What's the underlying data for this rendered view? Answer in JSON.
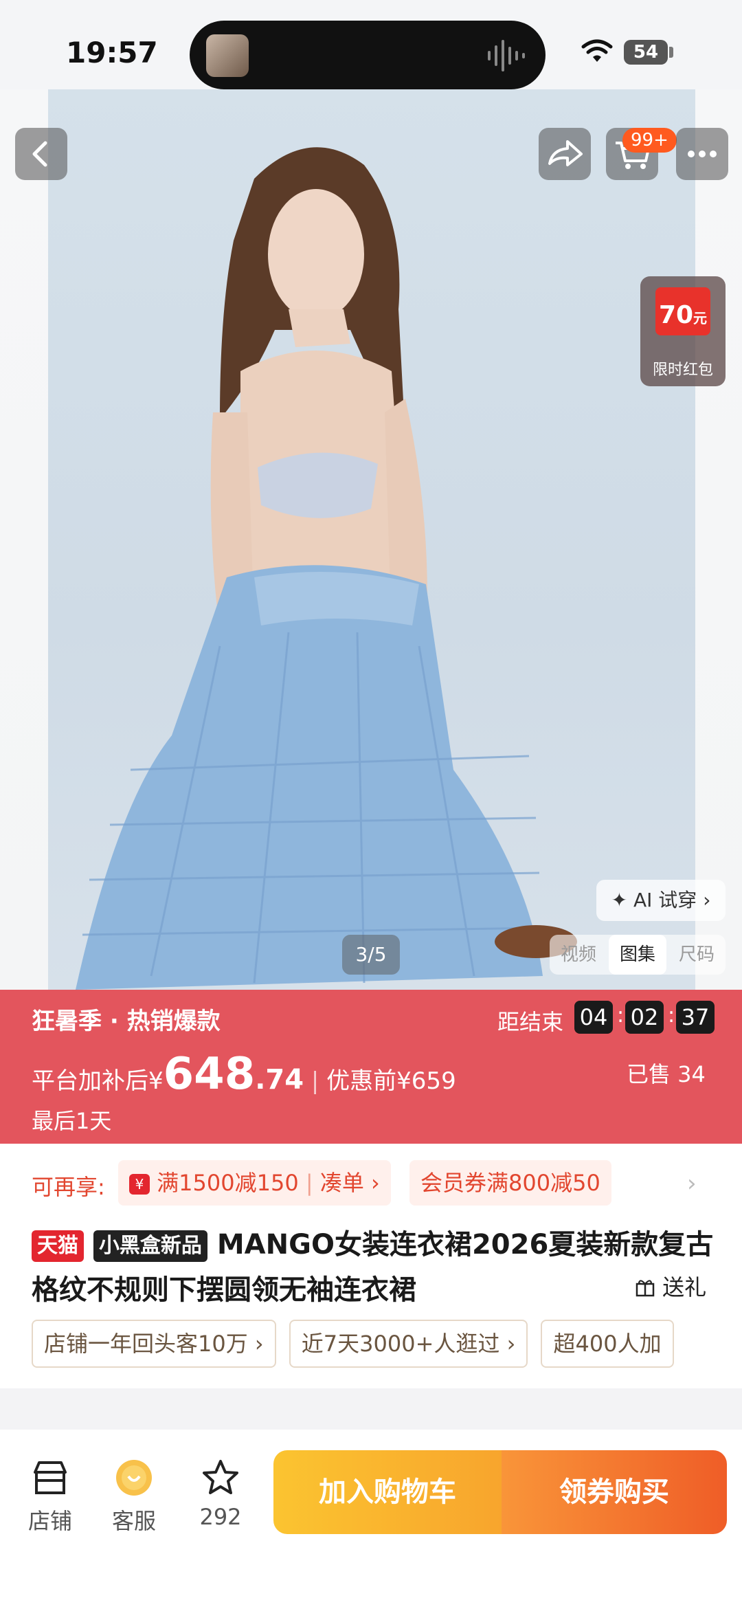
{
  "status_bar": {
    "time": "19:57",
    "battery": "54"
  },
  "header": {
    "cart_badge": "99+"
  },
  "redpack": {
    "amount": "70",
    "unit": "元",
    "label": "限时红包"
  },
  "gallery": {
    "ai_try": "AI 试穿",
    "counter": "3/5",
    "tabs": [
      "视频",
      "图集",
      "尺码"
    ]
  },
  "promo": {
    "tag": "狂暑季 · 热销爆款",
    "ends_label": "距结束",
    "countdown": [
      "04",
      "02",
      "37"
    ],
    "price_prefix": "平台加补后",
    "currency": "¥",
    "price_int": "648",
    "price_dec": ".74",
    "orig_label": "优惠前¥659",
    "sold": "已售 34",
    "last_day": "最后1天"
  },
  "coupons": {
    "lead": "可再享:",
    "c1_main": "满1500减150",
    "c1_action": "凑单",
    "c2": "会员券满800减50"
  },
  "product": {
    "tag_tmall": "天猫",
    "tag_blackbox": "小黑盒新品",
    "title": "MANGO女装连衣裙2026夏装新款复古格纹不规则下摆圆领无袖连衣裙",
    "gift": "送礼"
  },
  "chips": [
    "店铺一年回头客10万",
    "近7天3000+人逛过",
    "超400人加"
  ],
  "bottom_bar": {
    "shop": "店铺",
    "service": "客服",
    "fav_count": "292",
    "add_cart": "加入购物车",
    "buy": "领券购买"
  },
  "colors": {
    "promo_bg": "#e3555d",
    "accent": "#ef5d27",
    "cart_btn": "#fbc430"
  }
}
